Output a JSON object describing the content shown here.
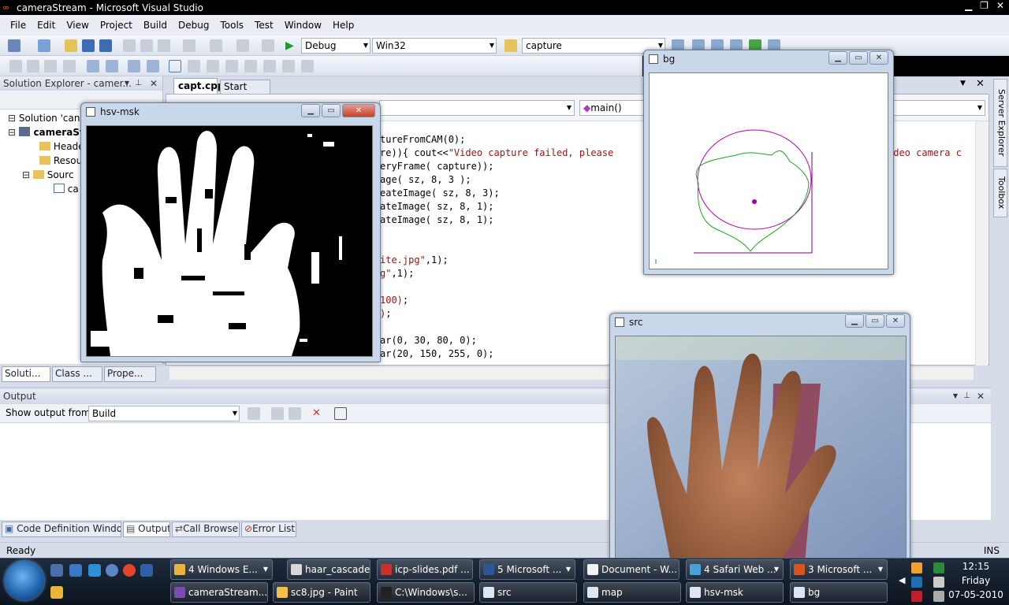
{
  "vs_title": "cameraStream - Microsoft Visual Studio",
  "menu": [
    "File",
    "Edit",
    "View",
    "Project",
    "Build",
    "Debug",
    "Tools",
    "Test",
    "Window",
    "Help"
  ],
  "toolbar": {
    "config": "Debug",
    "platform": "Win32",
    "find": "capture"
  },
  "solution_explorer": {
    "title": "Solution Explorer - camer...",
    "items": [
      "Solution 'can",
      "cameraSt",
      "Heade",
      "Resou",
      "Sourc",
      "ca"
    ]
  },
  "panel_tabs": [
    "Soluti...",
    "Class ...",
    "Prope..."
  ],
  "editor": {
    "tabs": [
      "capt.cpp",
      "Start Page"
    ],
    "nav_member": "main()",
    "code": [
      {
        "t": "tureFromCAM(0);"
      },
      {
        "t": "re)){ cout<<",
        "s": "\"Video capture failed, please",
        "tail": "ideo camera c"
      },
      {
        "t": "eryFrame( capture));"
      },
      {
        "t": "age( sz, 8, 3 );"
      },
      {
        "t": "eateImage( sz, 8, 3);"
      },
      {
        "t": "ateImage( sz, 8, 1);"
      },
      {
        "t": "ateImage( sz, 8, 1);"
      },
      {
        "t": ""
      },
      {
        "t": ""
      },
      {
        "s": "ite.jpg\"",
        "t2": ",1);"
      },
      {
        "s": "g\"",
        "t2": ",1);"
      },
      {
        "t": ""
      },
      {
        "s": "100)",
        "t2": ";"
      },
      {
        "s": ")",
        "t2": ";"
      },
      {
        "t": ""
      },
      {
        "t": "ar(0, 30, 80, 0);"
      },
      {
        "t": "ar(20, 150, 255, 0);"
      }
    ]
  },
  "output": {
    "title": "Output",
    "show_from_label": "Show output from:",
    "show_from_value": "Build"
  },
  "bottom_tabs": [
    "Code Definition Window",
    "Output",
    "Call Browser",
    "Error List"
  ],
  "right_rail": [
    "Server Explorer",
    "Toolbox"
  ],
  "status": {
    "left": "Ready",
    "right": "INS"
  },
  "windows": {
    "hsv": {
      "title": "hsv-msk"
    },
    "bg": {
      "title": "bg"
    },
    "src": {
      "title": "src"
    }
  },
  "taskbar": {
    "row1": [
      {
        "label": "4 Windows E...",
        "color": "#e8b43a",
        "arrow": true
      },
      {
        "label": "haar_cascade.t...",
        "color": "#d9d9d9",
        "arrow": false
      },
      {
        "label": "icp-slides.pdf ...",
        "color": "#c9302c",
        "arrow": false
      },
      {
        "label": "5 Microsoft ...",
        "color": "#2b5797",
        "arrow": true
      },
      {
        "label": "Document - W...",
        "color": "#f2f2f2",
        "arrow": false
      },
      {
        "label": "4 Safari Web ...",
        "color": "#4aa0d8",
        "arrow": true
      },
      {
        "label": "3 Microsoft ...",
        "color": "#d8561e",
        "arrow": true
      }
    ],
    "row2": [
      {
        "label": "cameraStream...",
        "color": "#7a4bb0"
      },
      {
        "label": "sc8.jpg - Paint",
        "color": "#f3c04a"
      },
      {
        "label": "C:\\Windows\\s...",
        "color": "#222"
      },
      {
        "label": "src",
        "color": "#dde6f2"
      },
      {
        "label": "map",
        "color": "#dde6f2"
      },
      {
        "label": "hsv-msk",
        "color": "#dde6f2"
      },
      {
        "label": "bg",
        "color": "#dde6f2"
      }
    ],
    "clock": {
      "time": "12:15",
      "day": "Friday",
      "date": "07-05-2010"
    }
  }
}
